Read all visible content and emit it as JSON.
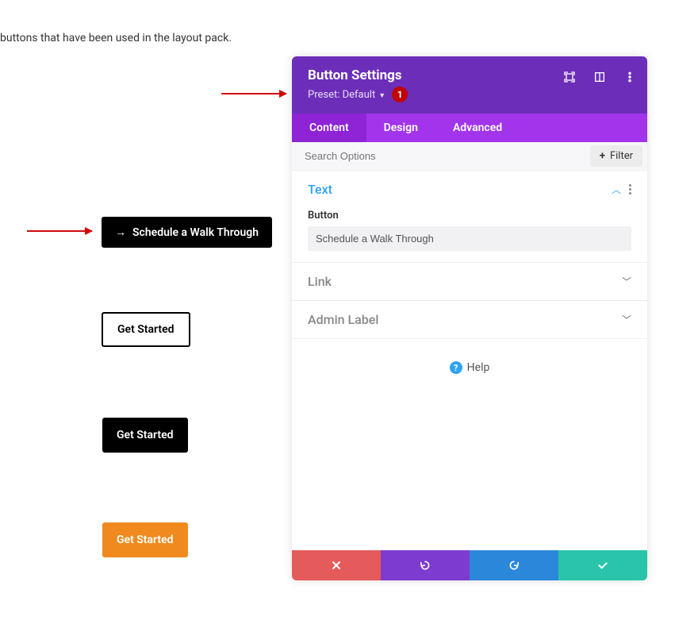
{
  "intro_text": "buttons that have been used in the layout pack.",
  "example_buttons": {
    "schedule": "Schedule a Walk Through",
    "get_started_outline": "Get Started",
    "get_started_dark": "Get Started",
    "get_started_orange": "Get Started"
  },
  "panel": {
    "title": "Button Settings",
    "preset_label": "Preset: Default",
    "step_badge": "1",
    "tabs": {
      "content": "Content",
      "design": "Design",
      "advanced": "Advanced"
    },
    "search_placeholder": "Search Options",
    "filter_label": "Filter",
    "sections": {
      "text": {
        "title": "Text",
        "field_label": "Button",
        "field_value": "Schedule a Walk Through"
      },
      "link": {
        "title": "Link"
      },
      "admin_label": {
        "title": "Admin Label"
      }
    },
    "help_label": "Help"
  },
  "icons": {
    "expand": "expand-icon",
    "columns": "columns-icon",
    "kebab": "kebab-icon",
    "plus": "plus-icon",
    "chevron_up": "chevron-up-icon",
    "chevron_down": "chevron-down-icon",
    "close": "close-icon",
    "undo": "undo-icon",
    "redo": "redo-icon",
    "check": "check-icon",
    "help": "help-icon",
    "arrow_right": "arrow-right-icon"
  },
  "colors": {
    "header_purple": "#6c2eb9",
    "tab_purple": "#a235ec",
    "accent_blue": "#2ea3f2",
    "footer_red": "#e55a5a",
    "footer_purple": "#7e3bd0",
    "footer_blue": "#2b87da",
    "footer_green": "#29c4a9",
    "orange": "#f08a1f",
    "badge_red": "#c00303",
    "arrow_red": "#d20808"
  }
}
